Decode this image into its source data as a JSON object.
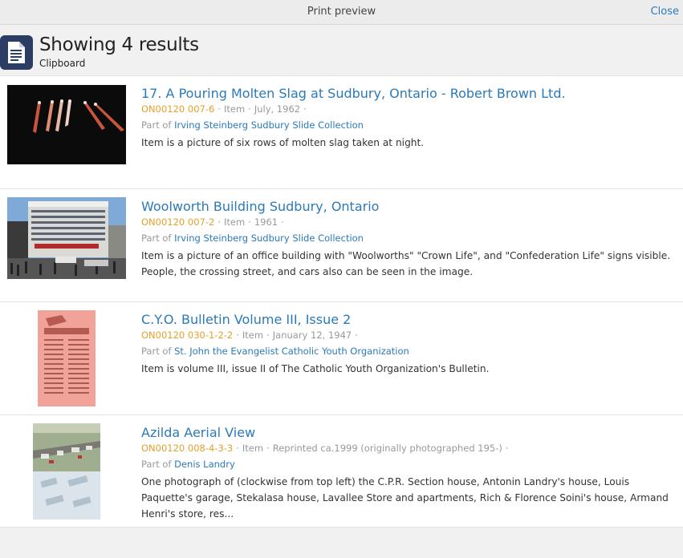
{
  "topbar": {
    "title": "Print preview",
    "close_label": "Close"
  },
  "header": {
    "title": "Showing 4 results",
    "subtitle": "Clipboard",
    "icon": "document-icon"
  },
  "results": [
    {
      "title": "17. A Pouring Molten Slag at Sudbury, Ontario - Robert Brown Ltd.",
      "ref": "ON00120 007-6",
      "level": "Item",
      "date": "July, 1962",
      "part_of_label": "Part of",
      "part_of": "Irving Steinberg Sudbury Slide Collection",
      "description": "Item is a picture of six rows of molten slag taken at night."
    },
    {
      "title": "Woolworth Building Sudbury, Ontario",
      "ref": "ON00120 007-2",
      "level": "Item",
      "date": "1961",
      "part_of_label": "Part of",
      "part_of": "Irving Steinberg Sudbury Slide Collection",
      "description": "Item is a picture of an office building with \"Woolworths\" \"Crown Life\", and \"Confederation Life\" signs visible. People, the crossing street, and cars also can be seen in the image."
    },
    {
      "title": "C.Y.O. Bulletin Volume III, Issue 2",
      "ref": "ON00120 030-1-2-2",
      "level": "Item",
      "date": "January 12, 1947",
      "part_of_label": "Part of",
      "part_of": "St. John the Evangelist Catholic Youth Organization",
      "description": "Item is volume III, issue II of The Catholic Youth Organization's Bulletin."
    },
    {
      "title": "Azilda Aerial View",
      "ref": "ON00120 008-4-3-3",
      "level": "Item",
      "date": "Reprinted ca.1999 (originally photographed 195-)",
      "part_of_label": "Part of",
      "part_of": "Denis Landry",
      "description": "One photograph of (clockwise from top left) the C.P.R. Section house, Antonin Landry's house, Louis Paquette's garage, Stekalasa house, Lavallee Store and apartments, Rich & Florence Soini's house, Armand Henri's store, res..."
    }
  ]
}
